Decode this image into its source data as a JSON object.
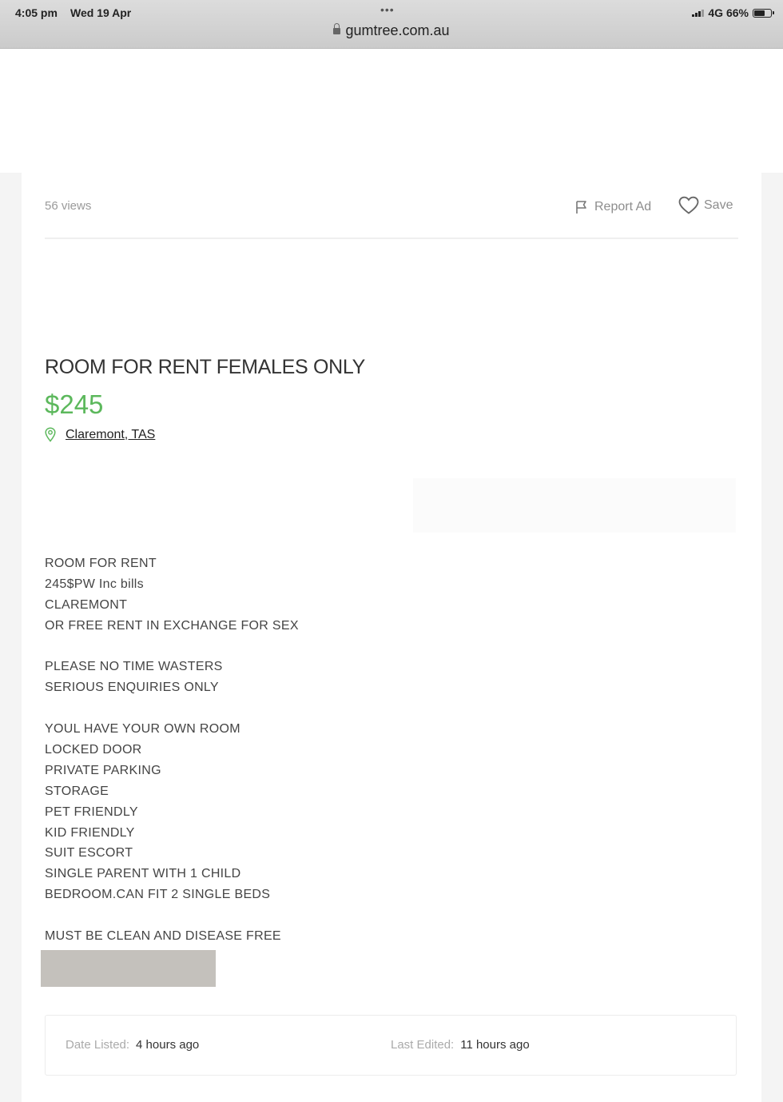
{
  "status_bar": {
    "time": "4:05 pm",
    "date": "Wed 19 Apr",
    "network": "4G",
    "battery": "66%",
    "url": "gumtree.com.au"
  },
  "ad": {
    "views": "56 views",
    "report_label": "Report Ad",
    "save_label": "Save",
    "title": "ROOM FOR RENT FEMALES ONLY",
    "price": "$245",
    "location": "Claremont, TAS",
    "description": [
      "ROOM FOR RENT",
      "245$PW Inc bills",
      "CLAREMONT",
      "OR FREE RENT IN EXCHANGE FOR SEX",
      "",
      "PLEASE NO TIME WASTERS",
      "SERIOUS ENQUIRIES ONLY",
      "",
      "YOUL HAVE YOUR OWN ROOM",
      "LOCKED DOOR",
      "PRIVATE PARKING",
      "STORAGE",
      "PET FRIENDLY",
      "KID FRIENDLY",
      "SUIT ESCORT",
      "SINGLE PARENT WITH 1 CHILD",
      "BEDROOM.CAN FIT 2 SINGLE BEDS",
      "",
      "MUST BE CLEAN AND DISEASE FREE"
    ],
    "date_listed_label": "Date Listed:",
    "date_listed_value": "4 hours ago",
    "last_edited_label": "Last Edited:",
    "last_edited_value": "11 hours ago"
  },
  "colors": {
    "price": "#5cb85c",
    "redaction": "#c4c1bc"
  },
  "icons": [
    "lock-icon",
    "signal-icon",
    "battery-icon",
    "flag-icon",
    "heart-icon",
    "location-pin-icon"
  ]
}
